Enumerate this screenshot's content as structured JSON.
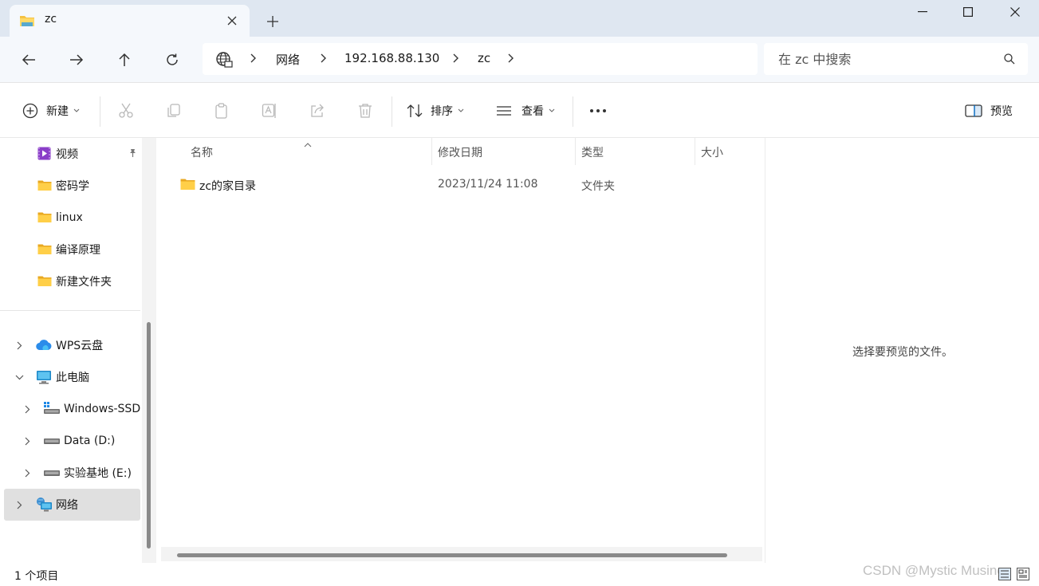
{
  "window": {
    "tab_title": "zc",
    "colors": {
      "titlebar": "#dfe7f1",
      "folder": "#f5c243",
      "accent": "#0067c0"
    }
  },
  "address": {
    "parts": [
      "网络",
      "192.168.88.130",
      "zc"
    ]
  },
  "search": {
    "placeholder": "在 zc 中搜索"
  },
  "toolbar": {
    "new_label": "新建",
    "sort_label": "排序",
    "view_label": "查看",
    "preview_label": "预览",
    "icons": [
      "cut-icon",
      "copy-icon",
      "paste-icon",
      "rename-icon",
      "share-icon",
      "delete-icon"
    ]
  },
  "sidebar": {
    "items": [
      {
        "label": "视频",
        "icon": "video-folder-icon",
        "pinned": true
      },
      {
        "label": "密码学",
        "icon": "folder-icon"
      },
      {
        "label": "linux",
        "icon": "folder-icon"
      },
      {
        "label": "编译原理",
        "icon": "folder-icon"
      },
      {
        "label": "新建文件夹",
        "icon": "folder-icon"
      },
      {
        "label": "WPS云盘",
        "icon": "cloud-icon"
      },
      {
        "label": "此电脑",
        "icon": "computer-icon"
      },
      {
        "label": "Windows-SSD",
        "icon": "windows-drive-icon"
      },
      {
        "label": "Data (D:)",
        "icon": "drive-icon"
      },
      {
        "label": "实验基地 (E:)",
        "icon": "drive-icon"
      },
      {
        "label": "网络",
        "icon": "network-icon",
        "selected": true
      }
    ]
  },
  "columns": {
    "name": "名称",
    "modified": "修改日期",
    "type": "类型",
    "size": "大小"
  },
  "files": [
    {
      "name": "zc的家目录",
      "modified": "2023/11/24 11:08",
      "type": "文件夹",
      "size": ""
    }
  ],
  "preview": {
    "message": "选择要预览的文件。"
  },
  "status": {
    "item_count": "1 个项目",
    "watermark": "CSDN @Mystic Musings"
  }
}
